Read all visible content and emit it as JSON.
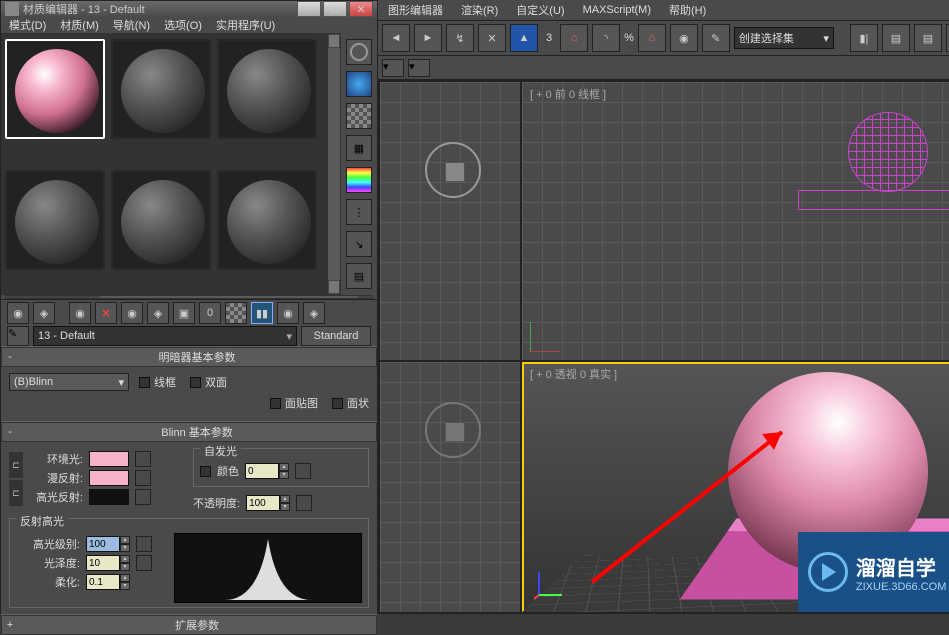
{
  "matEditor": {
    "title": "材质编辑器 - 13 - Default",
    "menu": [
      "模式(D)",
      "材质(M)",
      "导航(N)",
      "选项(O)",
      "实用程序(U)"
    ],
    "toolbarRow2": {
      "nameSelected": "13 - Default",
      "standardBtn": "Standard"
    },
    "shaderRollout": {
      "title": "明暗器基本参数",
      "shader": "(B)Blinn",
      "wireframe": "线框",
      "twoSided": "双面",
      "faceMap": "面贴图",
      "faceted": "面状"
    },
    "blinnRollout": {
      "title": "Blinn 基本参数",
      "ambientLbl": "环境光:",
      "diffuseLbl": "漫反射:",
      "specularLbl": "高光反射:",
      "selfIllumGroup": "自发光",
      "colorChk": "颜色",
      "colorVal": "0",
      "opacityLbl": "不透明度:",
      "opacityVal": "100",
      "specGroup": "反射高光",
      "specLevelLbl": "高光级别:",
      "specLevelVal": "100",
      "glossLbl": "光泽度:",
      "glossVal": "10",
      "softenLbl": "柔化:",
      "softenVal": "0.1"
    },
    "extRollout": {
      "title": "扩展参数"
    }
  },
  "maxMain": {
    "menu": [
      "图形编辑器",
      "渲染(R)",
      "自定义(U)",
      "MAXScript(M)",
      "帮助(H)"
    ],
    "toolbar": {
      "spinVal": "3",
      "dropdown": "创建选择集"
    },
    "viewports": {
      "topLeft": "",
      "front": "[ + 0 前 0 线框 ]",
      "bottomLeft": "",
      "persp": "[ + 0 透视 0 真实 ]"
    }
  },
  "watermark": {
    "brand": "溜溜自学",
    "url": "ZIXUE.3D66.COM"
  }
}
